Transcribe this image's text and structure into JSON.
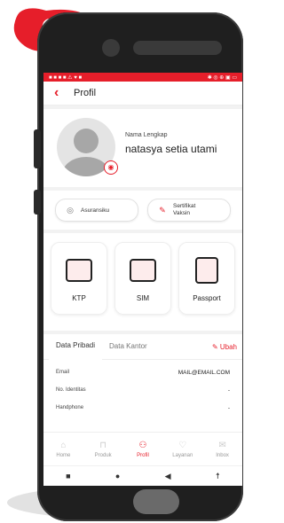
{
  "step_badge": {
    "number": "2",
    "color": "#e61e2a"
  },
  "status_bar": {
    "left": "■ ■ ■ ■ ⚠ ♥ ■",
    "right": "✱ ◎ ⊕ ▣ ▭"
  },
  "header": {
    "title": "Profil",
    "back_icon": "chevron-left-icon"
  },
  "profile": {
    "name_label": "Nama Lengkap",
    "name": "natasya setia utami",
    "camera_icon": "camera-icon"
  },
  "quick_cards": [
    {
      "label": "Asuransiku",
      "icon": "shield-icon"
    },
    {
      "label": "Sertifikat Vaksin",
      "icon": "syringe-icon"
    }
  ],
  "documents": [
    {
      "label": "KTP",
      "icon": "id-card-icon"
    },
    {
      "label": "SIM",
      "icon": "car-license-icon"
    },
    {
      "label": "Passport",
      "icon": "passport-icon"
    }
  ],
  "info": {
    "tabs": [
      {
        "label": "Data Pribadi"
      },
      {
        "label": "Data Kantor"
      }
    ],
    "edit_label": "Ubah",
    "rows": [
      {
        "label": "Email",
        "value": "MAIL@EMAIL.COM"
      },
      {
        "label": "No. Identitas",
        "value": "-"
      },
      {
        "label": "Handphone",
        "value": "-"
      }
    ]
  },
  "bottom_nav": [
    {
      "label": "Home",
      "icon": "home-icon"
    },
    {
      "label": "Produk",
      "icon": "bag-icon"
    },
    {
      "label": "Profil",
      "icon": "user-icon"
    },
    {
      "label": "Layanan",
      "icon": "heart-icon"
    },
    {
      "label": "Inbox",
      "icon": "mail-icon"
    }
  ],
  "system_nav": {
    "square": "■",
    "circle": "●",
    "back": "◀",
    "accessibility": "☨"
  },
  "colors": {
    "accent": "#e61e2a",
    "phone": "#1f1f1f",
    "screen_bg": "#f2f2f2"
  }
}
